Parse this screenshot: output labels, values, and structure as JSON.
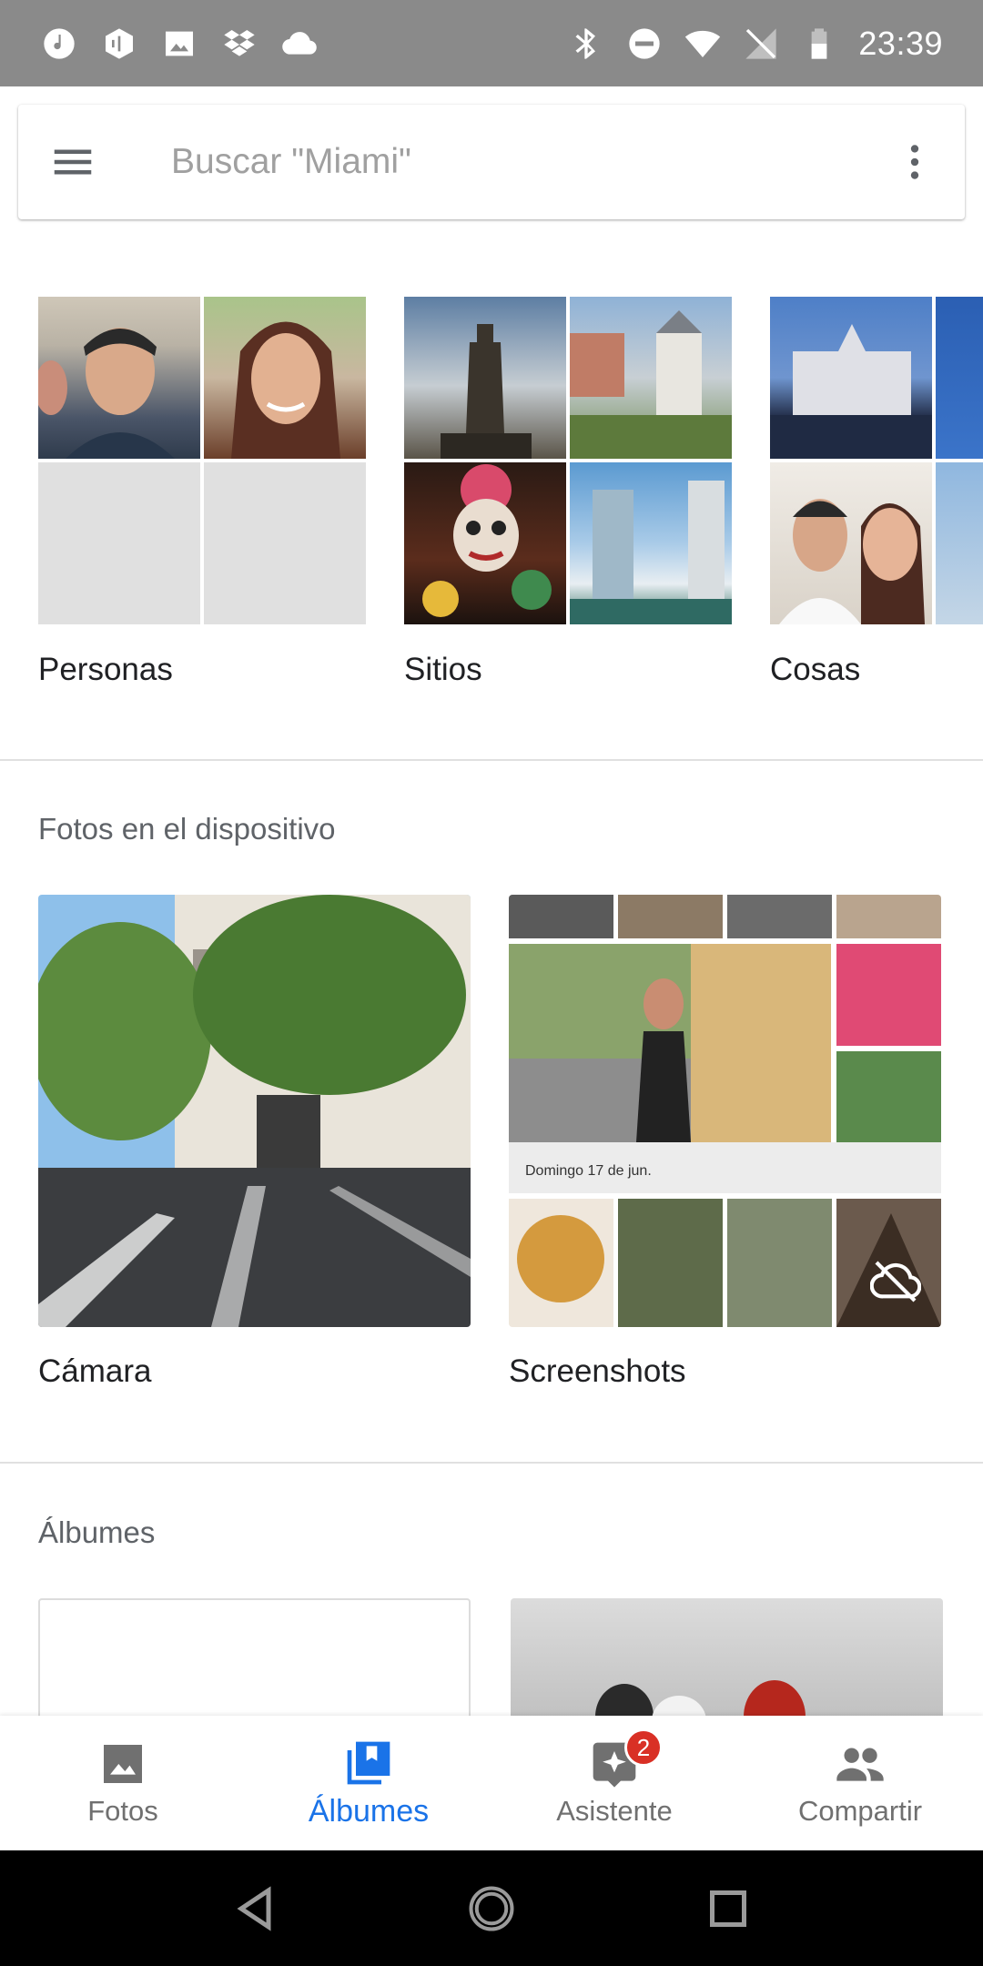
{
  "status_bar": {
    "time": "23:39",
    "left_icons": [
      "music-icon",
      "hexagon-app-icon",
      "image-icon",
      "dropbox-icon",
      "cloud-icon"
    ],
    "right_icons": [
      "bluetooth-icon",
      "do-not-disturb-icon",
      "wifi-icon",
      "no-signal-icon",
      "battery-icon"
    ]
  },
  "search": {
    "placeholder": "Buscar \"Miami\"",
    "value": ""
  },
  "categories": [
    {
      "label": "Personas"
    },
    {
      "label": "Sitios"
    },
    {
      "label": "Cosas"
    }
  ],
  "device_section": {
    "title": "Fotos en el dispositivo",
    "albums": [
      {
        "label": "Cámara"
      },
      {
        "label": "Screenshots",
        "screenshot_date": "Domingo 17 de jun."
      }
    ]
  },
  "albums_section": {
    "title": "Álbumes"
  },
  "bottom_nav": {
    "items": [
      {
        "label": "Fotos",
        "icon": "photo-icon",
        "active": false
      },
      {
        "label": "Álbumes",
        "icon": "albums-icon",
        "active": true
      },
      {
        "label": "Asistente",
        "icon": "assistant-icon",
        "active": false,
        "badge": "2"
      },
      {
        "label": "Compartir",
        "icon": "people-icon",
        "active": false
      }
    ]
  },
  "colors": {
    "status_bar_bg": "#8a8a8a",
    "accent": "#1a73e8",
    "badge": "#d93025"
  }
}
